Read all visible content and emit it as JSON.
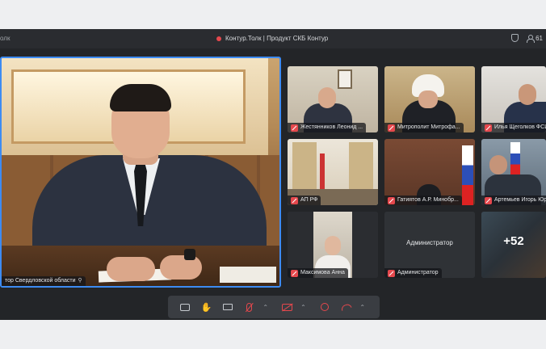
{
  "titlebar": {
    "app_fragment": "олк",
    "title": "Контур.Толк | Продукт СКБ Контур",
    "participants_count": "61"
  },
  "main_speaker": {
    "label": "тор Свердловской области"
  },
  "tiles": [
    {
      "label": "Жестянников Леонид ..."
    },
    {
      "label": "Митрополит Митрофа..."
    },
    {
      "label": "Илья Щеголков ФСИ"
    },
    {
      "label": "АП РФ"
    },
    {
      "label": "Гатиятов А.Р. Минобр..."
    },
    {
      "label": "Артемьев Игорь Юр"
    },
    {
      "label": "Максимова Анна"
    },
    {
      "label": "Администратор",
      "center_text": "Администратор"
    },
    {
      "center_text": "+52"
    }
  ],
  "colors": {
    "accent": "#3d8bf2",
    "danger": "#e5484d",
    "background": "#232528"
  },
  "toolbar": {
    "icons": [
      "chat-icon",
      "raise-hand-icon",
      "screen-share-icon",
      "mic-off-icon",
      "camera-off-icon",
      "record-icon",
      "hang-up-icon"
    ]
  }
}
